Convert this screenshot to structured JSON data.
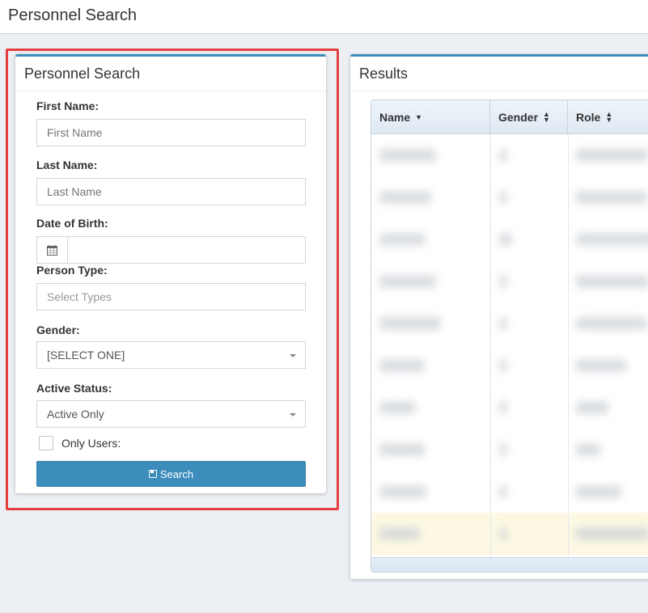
{
  "page": {
    "title": "Personnel Search"
  },
  "search_panel": {
    "title": "Personnel Search",
    "first_name": {
      "label": "First Name:",
      "placeholder": "First Name",
      "value": ""
    },
    "last_name": {
      "label": "Last Name:",
      "placeholder": "Last Name",
      "value": ""
    },
    "dob": {
      "label": "Date of Birth:",
      "icon": "calendar-icon",
      "value": ""
    },
    "person_type": {
      "label": "Person Type:",
      "placeholder": "Select Types"
    },
    "gender": {
      "label": "Gender:",
      "selected": "[SELECT ONE]"
    },
    "active_status": {
      "label": "Active Status:",
      "selected": "Active Only"
    },
    "only_users": {
      "label": "Only Users:",
      "checked": false
    },
    "search_button": {
      "label": "Search",
      "icon": "save-icon"
    }
  },
  "results_panel": {
    "title": "Results",
    "columns": [
      "Name",
      "Gender",
      "Role"
    ],
    "row_count": 10,
    "highlighted_row": 10
  },
  "colors": {
    "accent": "#3c8dbc",
    "highlight_frame": "#e53e3e",
    "highlight_row": "#fcf8e3"
  }
}
